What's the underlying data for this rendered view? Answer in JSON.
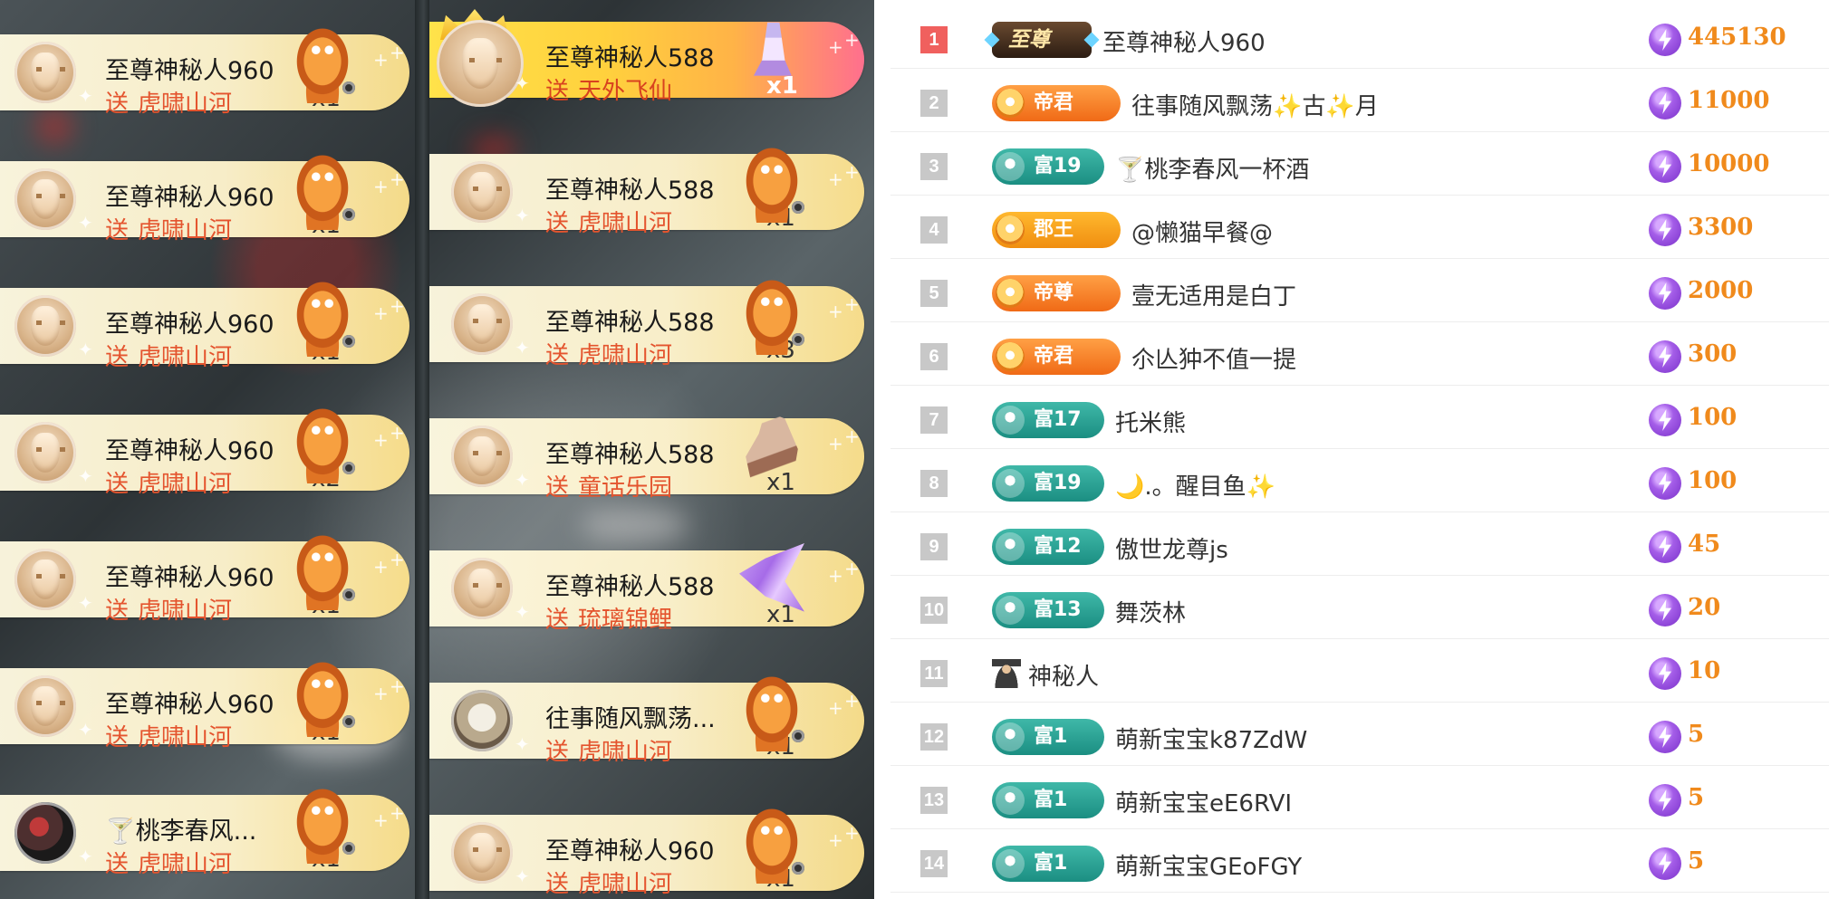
{
  "left_column": [
    {
      "sender": "至尊神秘人960",
      "action": "送",
      "gift": "虎啸山河",
      "count": "x1",
      "avatar": "mask",
      "gift_icon": "tiger-gift"
    },
    {
      "sender": "至尊神秘人960",
      "action": "送",
      "gift": "虎啸山河",
      "count": "x1",
      "avatar": "mask",
      "gift_icon": "tiger-gift"
    },
    {
      "sender": "至尊神秘人960",
      "action": "送",
      "gift": "虎啸山河",
      "count": "x1",
      "avatar": "mask",
      "gift_icon": "tiger-gift"
    },
    {
      "sender": "至尊神秘人960",
      "action": "送",
      "gift": "虎啸山河",
      "count": "x2",
      "avatar": "mask",
      "gift_icon": "tiger-gift"
    },
    {
      "sender": "至尊神秘人960",
      "action": "送",
      "gift": "虎啸山河",
      "count": "x1",
      "avatar": "mask",
      "gift_icon": "tiger-gift"
    },
    {
      "sender": "至尊神秘人960",
      "action": "送",
      "gift": "虎啸山河",
      "count": "x1",
      "avatar": "mask",
      "gift_icon": "tiger-gift"
    },
    {
      "sender": "🍸桃李春风...",
      "action": "送",
      "gift": "虎啸山河",
      "count": "x1",
      "avatar": "photo-dark",
      "gift_icon": "tiger-gift"
    }
  ],
  "right_column": [
    {
      "sender": "至尊神秘人588",
      "action": "送",
      "gift": "天外飞仙",
      "count": "x1",
      "avatar": "mask",
      "gift_icon": "fairy-gift",
      "highlight": true
    },
    {
      "sender": "至尊神秘人588",
      "action": "送",
      "gift": "虎啸山河",
      "count": "x1",
      "avatar": "mask",
      "gift_icon": "tiger-gift"
    },
    {
      "sender": "至尊神秘人588",
      "action": "送",
      "gift": "虎啸山河",
      "count": "x3",
      "avatar": "mask",
      "gift_icon": "tiger-gift"
    },
    {
      "sender": "至尊神秘人588",
      "action": "送",
      "gift": "童话乐园",
      "count": "x1",
      "avatar": "mask",
      "gift_icon": "horse-gift"
    },
    {
      "sender": "至尊神秘人588",
      "action": "送",
      "gift": "琉璃锦鲤",
      "count": "x1",
      "avatar": "mask",
      "gift_icon": "koi-gift"
    },
    {
      "sender": "往事随风飘荡...",
      "action": "送",
      "gift": "虎啸山河",
      "count": "x1",
      "avatar": "photo-cat",
      "gift_icon": "tiger-gift"
    },
    {
      "sender": "至尊神秘人960",
      "action": "送",
      "gift": "虎啸山河",
      "count": "x1",
      "avatar": "mask",
      "gift_icon": "tiger-gift"
    }
  ],
  "ranking": [
    {
      "rank": "1",
      "badge_type": "supreme",
      "badge_label": "至尊",
      "name": "至尊神秘人960",
      "score": "445130"
    },
    {
      "rank": "2",
      "badge_type": "emperor",
      "badge_label": "帝君",
      "name": "往事随风飘荡✨古✨月",
      "score": "11000"
    },
    {
      "rank": "3",
      "badge_type": "rich",
      "badge_label": "富19",
      "name": "🍸桃李春风一杯酒",
      "score": "10000"
    },
    {
      "rank": "4",
      "badge_type": "prince",
      "badge_label": "郡王",
      "name": "@懒猫早餐@",
      "score": "3300"
    },
    {
      "rank": "5",
      "badge_type": "emperor",
      "badge_label": "帝尊",
      "name": "壹无适用是白丁",
      "score": "2000"
    },
    {
      "rank": "6",
      "badge_type": "emperor",
      "badge_label": "帝君",
      "name": "尒亾狆不值一提",
      "score": "300"
    },
    {
      "rank": "7",
      "badge_type": "rich",
      "badge_label": "富17",
      "name": "托米熊",
      "score": "100"
    },
    {
      "rank": "8",
      "badge_type": "rich",
      "badge_label": "富19",
      "name": "🌙.。醒目鱼✨",
      "score": "100"
    },
    {
      "rank": "9",
      "badge_type": "rich",
      "badge_label": "富12",
      "name": "傲世龙尊js",
      "score": "45"
    },
    {
      "rank": "10",
      "badge_type": "rich",
      "badge_label": "富13",
      "name": "舞茨林",
      "score": "20"
    },
    {
      "rank": "11",
      "badge_type": "mystery",
      "badge_label": "",
      "name": "神秘人",
      "score": "10"
    },
    {
      "rank": "12",
      "badge_type": "rich",
      "badge_label": "富1",
      "name": "萌新宝宝k87ZdW",
      "score": "5"
    },
    {
      "rank": "13",
      "badge_type": "rich",
      "badge_label": "富1",
      "name": "萌新宝宝eE6RVI",
      "score": "5"
    },
    {
      "rank": "14",
      "badge_type": "rich",
      "badge_label": "富1",
      "name": "萌新宝宝GEoFGY",
      "score": "5"
    }
  ]
}
